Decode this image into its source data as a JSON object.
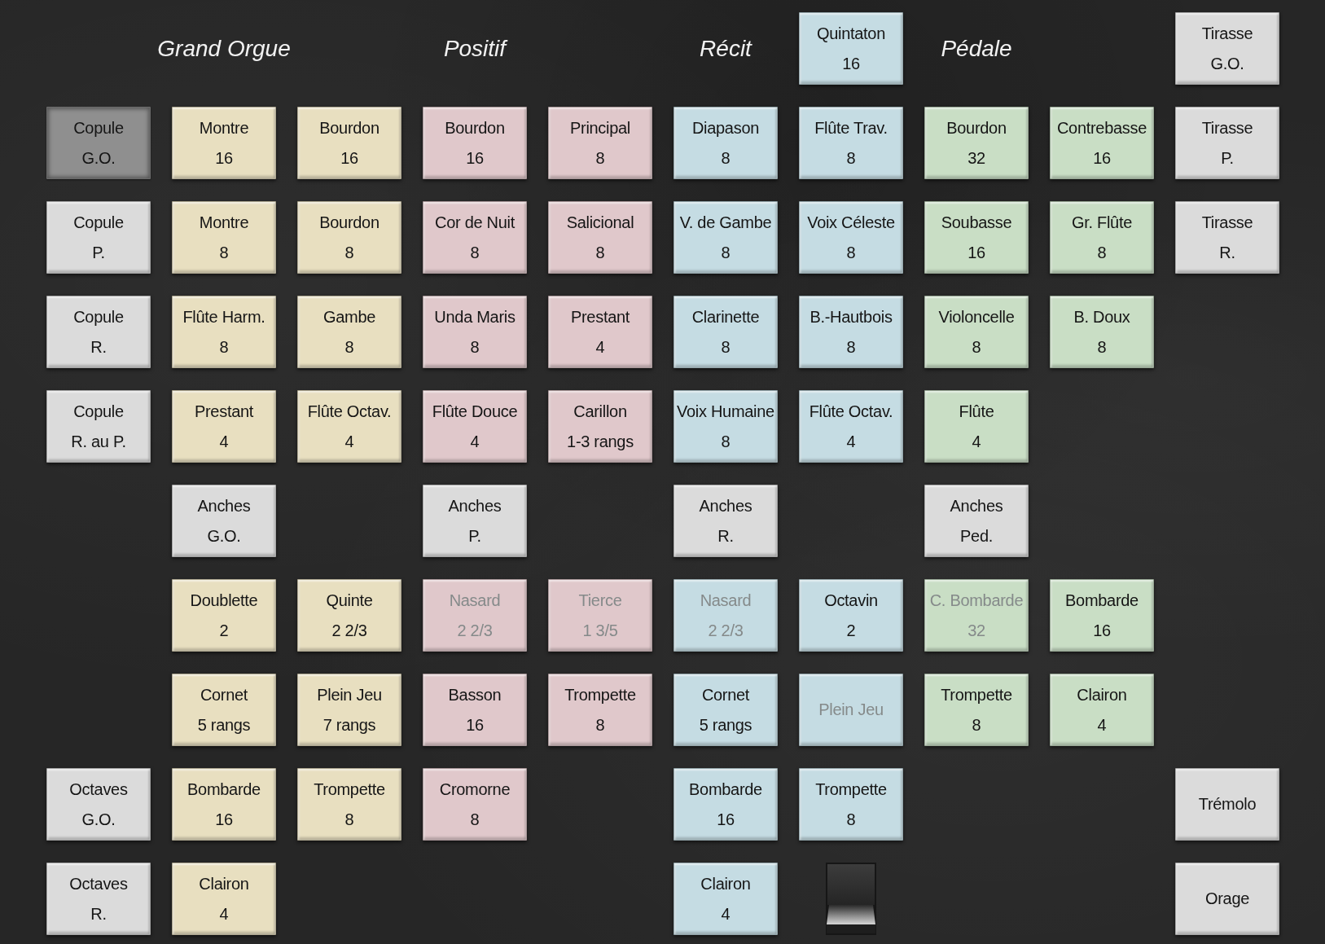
{
  "rows": [
    {
      "cells": [
        {
          "kind": "blank"
        },
        {
          "kind": "heading",
          "text": "Grand Orgue"
        },
        {
          "kind": "blank"
        },
        {
          "kind": "heading",
          "text": "Positif"
        },
        {
          "kind": "blank"
        },
        {
          "kind": "heading",
          "text": "Récit"
        },
        {
          "kind": "stop",
          "name": "Quintaton",
          "pitch": "16",
          "color": "#c5dce3",
          "on": false,
          "disabled": false
        },
        {
          "kind": "heading",
          "text": "Pédale"
        },
        {
          "kind": "blank"
        },
        {
          "kind": "stop",
          "name": "Tirasse",
          "pitch": "G.O.",
          "color": "#dbdbdb",
          "on": false,
          "disabled": false
        }
      ]
    },
    {
      "cells": [
        {
          "kind": "stop",
          "name": "Copule",
          "pitch": "G.O.",
          "color": "#8f8f8f",
          "on": true,
          "disabled": false
        },
        {
          "kind": "stop",
          "name": "Montre",
          "pitch": "16",
          "color": "#e8dfc0",
          "on": false,
          "disabled": false
        },
        {
          "kind": "stop",
          "name": "Bourdon",
          "pitch": "16",
          "color": "#e8dfc0",
          "on": false,
          "disabled": false
        },
        {
          "kind": "stop",
          "name": "Bourdon",
          "pitch": "16",
          "color": "#e0c8cb",
          "on": false,
          "disabled": false
        },
        {
          "kind": "stop",
          "name": "Principal",
          "pitch": "8",
          "color": "#e0c8cb",
          "on": false,
          "disabled": false
        },
        {
          "kind": "stop",
          "name": "Diapason",
          "pitch": "8",
          "color": "#c5dce3",
          "on": false,
          "disabled": false
        },
        {
          "kind": "stop",
          "name": "Flûte Trav.",
          "pitch": "8",
          "color": "#c5dce3",
          "on": false,
          "disabled": false
        },
        {
          "kind": "stop",
          "name": "Bourdon",
          "pitch": "32",
          "color": "#c9dec5",
          "on": false,
          "disabled": false
        },
        {
          "kind": "stop",
          "name": "Contrebasse",
          "pitch": "16",
          "color": "#c9dec5",
          "on": false,
          "disabled": false
        },
        {
          "kind": "stop",
          "name": "Tirasse",
          "pitch": "P.",
          "color": "#dbdbdb",
          "on": false,
          "disabled": false
        }
      ]
    },
    {
      "cells": [
        {
          "kind": "stop",
          "name": "Copule",
          "pitch": "P.",
          "color": "#dbdbdb",
          "on": false,
          "disabled": false
        },
        {
          "kind": "stop",
          "name": "Montre",
          "pitch": "8",
          "color": "#e8dfc0",
          "on": false,
          "disabled": false
        },
        {
          "kind": "stop",
          "name": "Bourdon",
          "pitch": "8",
          "color": "#e8dfc0",
          "on": false,
          "disabled": false
        },
        {
          "kind": "stop",
          "name": "Cor de Nuit",
          "pitch": "8",
          "color": "#e0c8cb",
          "on": false,
          "disabled": false
        },
        {
          "kind": "stop",
          "name": "Salicional",
          "pitch": "8",
          "color": "#e0c8cb",
          "on": false,
          "disabled": false
        },
        {
          "kind": "stop",
          "name": "V. de Gambe",
          "pitch": "8",
          "color": "#c5dce3",
          "on": false,
          "disabled": false
        },
        {
          "kind": "stop",
          "name": "Voix Céleste",
          "pitch": "8",
          "color": "#c5dce3",
          "on": false,
          "disabled": false
        },
        {
          "kind": "stop",
          "name": "Soubasse",
          "pitch": "16",
          "color": "#c9dec5",
          "on": false,
          "disabled": false
        },
        {
          "kind": "stop",
          "name": "Gr. Flûte",
          "pitch": "8",
          "color": "#c9dec5",
          "on": false,
          "disabled": false
        },
        {
          "kind": "stop",
          "name": "Tirasse",
          "pitch": "R.",
          "color": "#dbdbdb",
          "on": false,
          "disabled": false
        }
      ]
    },
    {
      "cells": [
        {
          "kind": "stop",
          "name": "Copule",
          "pitch": "R.",
          "color": "#dbdbdb",
          "on": false,
          "disabled": false
        },
        {
          "kind": "stop",
          "name": "Flûte Harm.",
          "pitch": "8",
          "color": "#e8dfc0",
          "on": false,
          "disabled": false
        },
        {
          "kind": "stop",
          "name": "Gambe",
          "pitch": "8",
          "color": "#e8dfc0",
          "on": false,
          "disabled": false
        },
        {
          "kind": "stop",
          "name": "Unda Maris",
          "pitch": "8",
          "color": "#e0c8cb",
          "on": false,
          "disabled": false
        },
        {
          "kind": "stop",
          "name": "Prestant",
          "pitch": "4",
          "color": "#e0c8cb",
          "on": false,
          "disabled": false
        },
        {
          "kind": "stop",
          "name": "Clarinette",
          "pitch": "8",
          "color": "#c5dce3",
          "on": false,
          "disabled": false
        },
        {
          "kind": "stop",
          "name": "B.-Hautbois",
          "pitch": "8",
          "color": "#c5dce3",
          "on": false,
          "disabled": false
        },
        {
          "kind": "stop",
          "name": "Violoncelle",
          "pitch": "8",
          "color": "#c9dec5",
          "on": false,
          "disabled": false
        },
        {
          "kind": "stop",
          "name": "B. Doux",
          "pitch": "8",
          "color": "#c9dec5",
          "on": false,
          "disabled": false
        }
      ]
    },
    {
      "cells": [
        {
          "kind": "stop",
          "name": "Copule",
          "pitch": "R. au P.",
          "color": "#dbdbdb",
          "on": false,
          "disabled": false
        },
        {
          "kind": "stop",
          "name": "Prestant",
          "pitch": "4",
          "color": "#e8dfc0",
          "on": false,
          "disabled": false
        },
        {
          "kind": "stop",
          "name": "Flûte Octav.",
          "pitch": "4",
          "color": "#e8dfc0",
          "on": false,
          "disabled": false
        },
        {
          "kind": "stop",
          "name": "Flûte Douce",
          "pitch": "4",
          "color": "#e0c8cb",
          "on": false,
          "disabled": false
        },
        {
          "kind": "stop",
          "name": "Carillon",
          "pitch": "1-3 rangs",
          "color": "#e0c8cb",
          "on": false,
          "disabled": false
        },
        {
          "kind": "stop",
          "name": "Voix Humaine",
          "pitch": "8",
          "color": "#c5dce3",
          "on": false,
          "disabled": false
        },
        {
          "kind": "stop",
          "name": "Flûte Octav.",
          "pitch": "4",
          "color": "#c5dce3",
          "on": false,
          "disabled": false
        },
        {
          "kind": "stop",
          "name": "Flûte",
          "pitch": "4",
          "color": "#c9dec5",
          "on": false,
          "disabled": false
        }
      ]
    },
    {
      "cells": [
        {
          "kind": "blank"
        },
        {
          "kind": "stop",
          "name": "Anches",
          "pitch": "G.O.",
          "color": "#dbdbdb",
          "on": false,
          "disabled": false
        },
        {
          "kind": "blank"
        },
        {
          "kind": "stop",
          "name": "Anches",
          "pitch": "P.",
          "color": "#dbdbdb",
          "on": false,
          "disabled": false
        },
        {
          "kind": "blank"
        },
        {
          "kind": "stop",
          "name": "Anches",
          "pitch": "R.",
          "color": "#dbdbdb",
          "on": false,
          "disabled": false
        },
        {
          "kind": "blank"
        },
        {
          "kind": "stop",
          "name": "Anches",
          "pitch": "Ped.",
          "color": "#dbdbdb",
          "on": false,
          "disabled": false
        }
      ]
    },
    {
      "cells": [
        {
          "kind": "blank"
        },
        {
          "kind": "stop",
          "name": "Doublette",
          "pitch": "2",
          "color": "#e8dfc0",
          "on": false,
          "disabled": false
        },
        {
          "kind": "stop",
          "name": "Quinte",
          "pitch": "2 2/3",
          "color": "#e8dfc0",
          "on": false,
          "disabled": false
        },
        {
          "kind": "stop",
          "name": "Nasard",
          "pitch": "2 2/3",
          "color": "#e0c8cb",
          "on": false,
          "disabled": true
        },
        {
          "kind": "stop",
          "name": "Tierce",
          "pitch": "1 3/5",
          "color": "#e0c8cb",
          "on": false,
          "disabled": true
        },
        {
          "kind": "stop",
          "name": "Nasard",
          "pitch": "2 2/3",
          "color": "#c5dce3",
          "on": false,
          "disabled": true
        },
        {
          "kind": "stop",
          "name": "Octavin",
          "pitch": "2",
          "color": "#c5dce3",
          "on": false,
          "disabled": false
        },
        {
          "kind": "stop",
          "name": "C. Bombarde",
          "pitch": "32",
          "color": "#c9dec5",
          "on": false,
          "disabled": true
        },
        {
          "kind": "stop",
          "name": "Bombarde",
          "pitch": "16",
          "color": "#c9dec5",
          "on": false,
          "disabled": false
        }
      ]
    },
    {
      "cells": [
        {
          "kind": "blank"
        },
        {
          "kind": "stop",
          "name": "Cornet",
          "pitch": "5 rangs",
          "color": "#e8dfc0",
          "on": false,
          "disabled": false
        },
        {
          "kind": "stop",
          "name": "Plein Jeu",
          "pitch": "7 rangs",
          "color": "#e8dfc0",
          "on": false,
          "disabled": false
        },
        {
          "kind": "stop",
          "name": "Basson",
          "pitch": "16",
          "color": "#e0c8cb",
          "on": false,
          "disabled": false
        },
        {
          "kind": "stop",
          "name": "Trompette",
          "pitch": "8",
          "color": "#e0c8cb",
          "on": false,
          "disabled": false
        },
        {
          "kind": "stop",
          "name": "Cornet",
          "pitch": "5 rangs",
          "color": "#c5dce3",
          "on": false,
          "disabled": false
        },
        {
          "kind": "stop",
          "name": "Plein Jeu",
          "color": "#c5dce3",
          "on": false,
          "disabled": true
        },
        {
          "kind": "stop",
          "name": "Trompette",
          "pitch": "8",
          "color": "#c9dec5",
          "on": false,
          "disabled": false
        },
        {
          "kind": "stop",
          "name": "Clairon",
          "pitch": "4",
          "color": "#c9dec5",
          "on": false,
          "disabled": false
        }
      ]
    },
    {
      "cells": [
        {
          "kind": "stop",
          "name": "Octaves",
          "pitch": "G.O.",
          "color": "#dbdbdb",
          "on": false,
          "disabled": false
        },
        {
          "kind": "stop",
          "name": "Bombarde",
          "pitch": "16",
          "color": "#e8dfc0",
          "on": false,
          "disabled": false
        },
        {
          "kind": "stop",
          "name": "Trompette",
          "pitch": "8",
          "color": "#e8dfc0",
          "on": false,
          "disabled": false
        },
        {
          "kind": "stop",
          "name": "Cromorne",
          "pitch": "8",
          "color": "#e0c8cb",
          "on": false,
          "disabled": false
        },
        {
          "kind": "blank"
        },
        {
          "kind": "stop",
          "name": "Bombarde",
          "pitch": "16",
          "color": "#c5dce3",
          "on": false,
          "disabled": false
        },
        {
          "kind": "stop",
          "name": "Trompette",
          "pitch": "8",
          "color": "#c5dce3",
          "on": false,
          "disabled": false
        },
        {
          "kind": "blank"
        },
        {
          "kind": "blank"
        },
        {
          "kind": "stop",
          "name": "Trémolo",
          "color": "#dbdbdb",
          "on": false,
          "disabled": false
        }
      ]
    },
    {
      "cells": [
        {
          "kind": "stop",
          "name": "Octaves",
          "pitch": "R.",
          "color": "#dbdbdb",
          "on": false,
          "disabled": false
        },
        {
          "kind": "stop",
          "name": "Clairon",
          "pitch": "4",
          "color": "#e8dfc0",
          "on": false,
          "disabled": false
        },
        {
          "kind": "blank"
        },
        {
          "kind": "blank"
        },
        {
          "kind": "blank"
        },
        {
          "kind": "stop",
          "name": "Clairon",
          "pitch": "4",
          "color": "#c5dce3",
          "on": false,
          "disabled": false
        },
        {
          "kind": "shoe"
        },
        {
          "kind": "blank"
        },
        {
          "kind": "blank"
        },
        {
          "kind": "stop",
          "name": "Orage",
          "color": "#dbdbdb",
          "on": false,
          "disabled": false
        }
      ]
    }
  ]
}
